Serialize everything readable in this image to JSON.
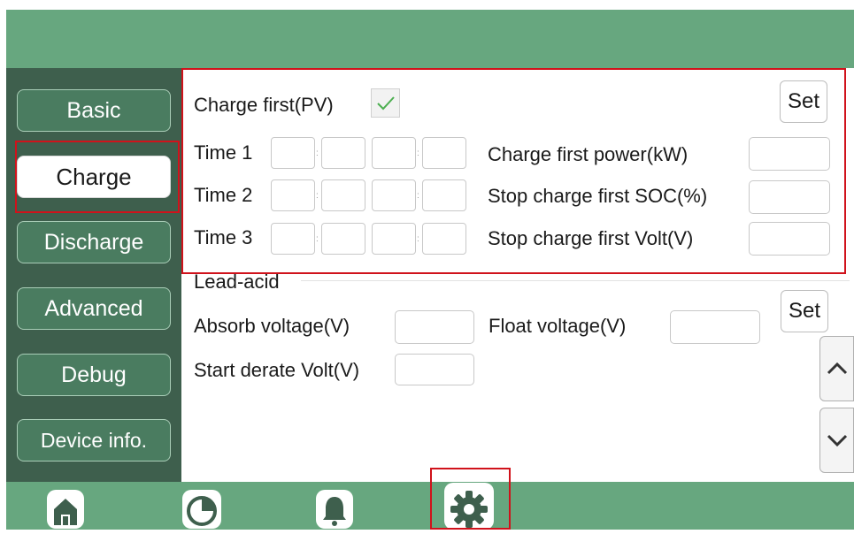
{
  "sidebar": {
    "items": [
      {
        "label": "Basic"
      },
      {
        "label": "Charge"
      },
      {
        "label": "Discharge"
      },
      {
        "label": "Advanced"
      },
      {
        "label": "Debug"
      },
      {
        "label": "Device info."
      }
    ],
    "active": "Charge"
  },
  "charge_panel": {
    "charge_first_label": "Charge first(PV)",
    "charge_first_checked": true,
    "set_label": "Set",
    "time_rows": [
      {
        "label": "Time 1"
      },
      {
        "label": "Time 2"
      },
      {
        "label": "Time 3"
      }
    ],
    "time_separator": ":",
    "fields": [
      {
        "label": "Charge first power(kW)",
        "value": ""
      },
      {
        "label": "Stop charge first SOC(%)",
        "value": ""
      },
      {
        "label": "Stop charge first Volt(V)",
        "value": ""
      }
    ]
  },
  "lead_acid": {
    "section_label": "Lead-acid",
    "set_label": "Set",
    "absorb_label": "Absorb voltage(V)",
    "absorb_value": "",
    "float_label": "Float voltage(V)",
    "float_value": "",
    "derate_label": "Start derate Volt(V)",
    "derate_value": ""
  },
  "scroll": {
    "up_icon": "chevron-up-icon",
    "down_icon": "chevron-down-icon"
  },
  "bottom_nav": {
    "tabs": [
      {
        "icon": "home-icon"
      },
      {
        "icon": "pie-chart-icon"
      },
      {
        "icon": "bell-icon"
      },
      {
        "icon": "gear-icon",
        "active": true
      }
    ]
  },
  "colors": {
    "header_green": "#67a77f",
    "sidebar_dark": "#3e5f4d",
    "nav_button": "#4a7c60",
    "highlight_red": "#d0121b",
    "check_green": "#4caf50"
  }
}
